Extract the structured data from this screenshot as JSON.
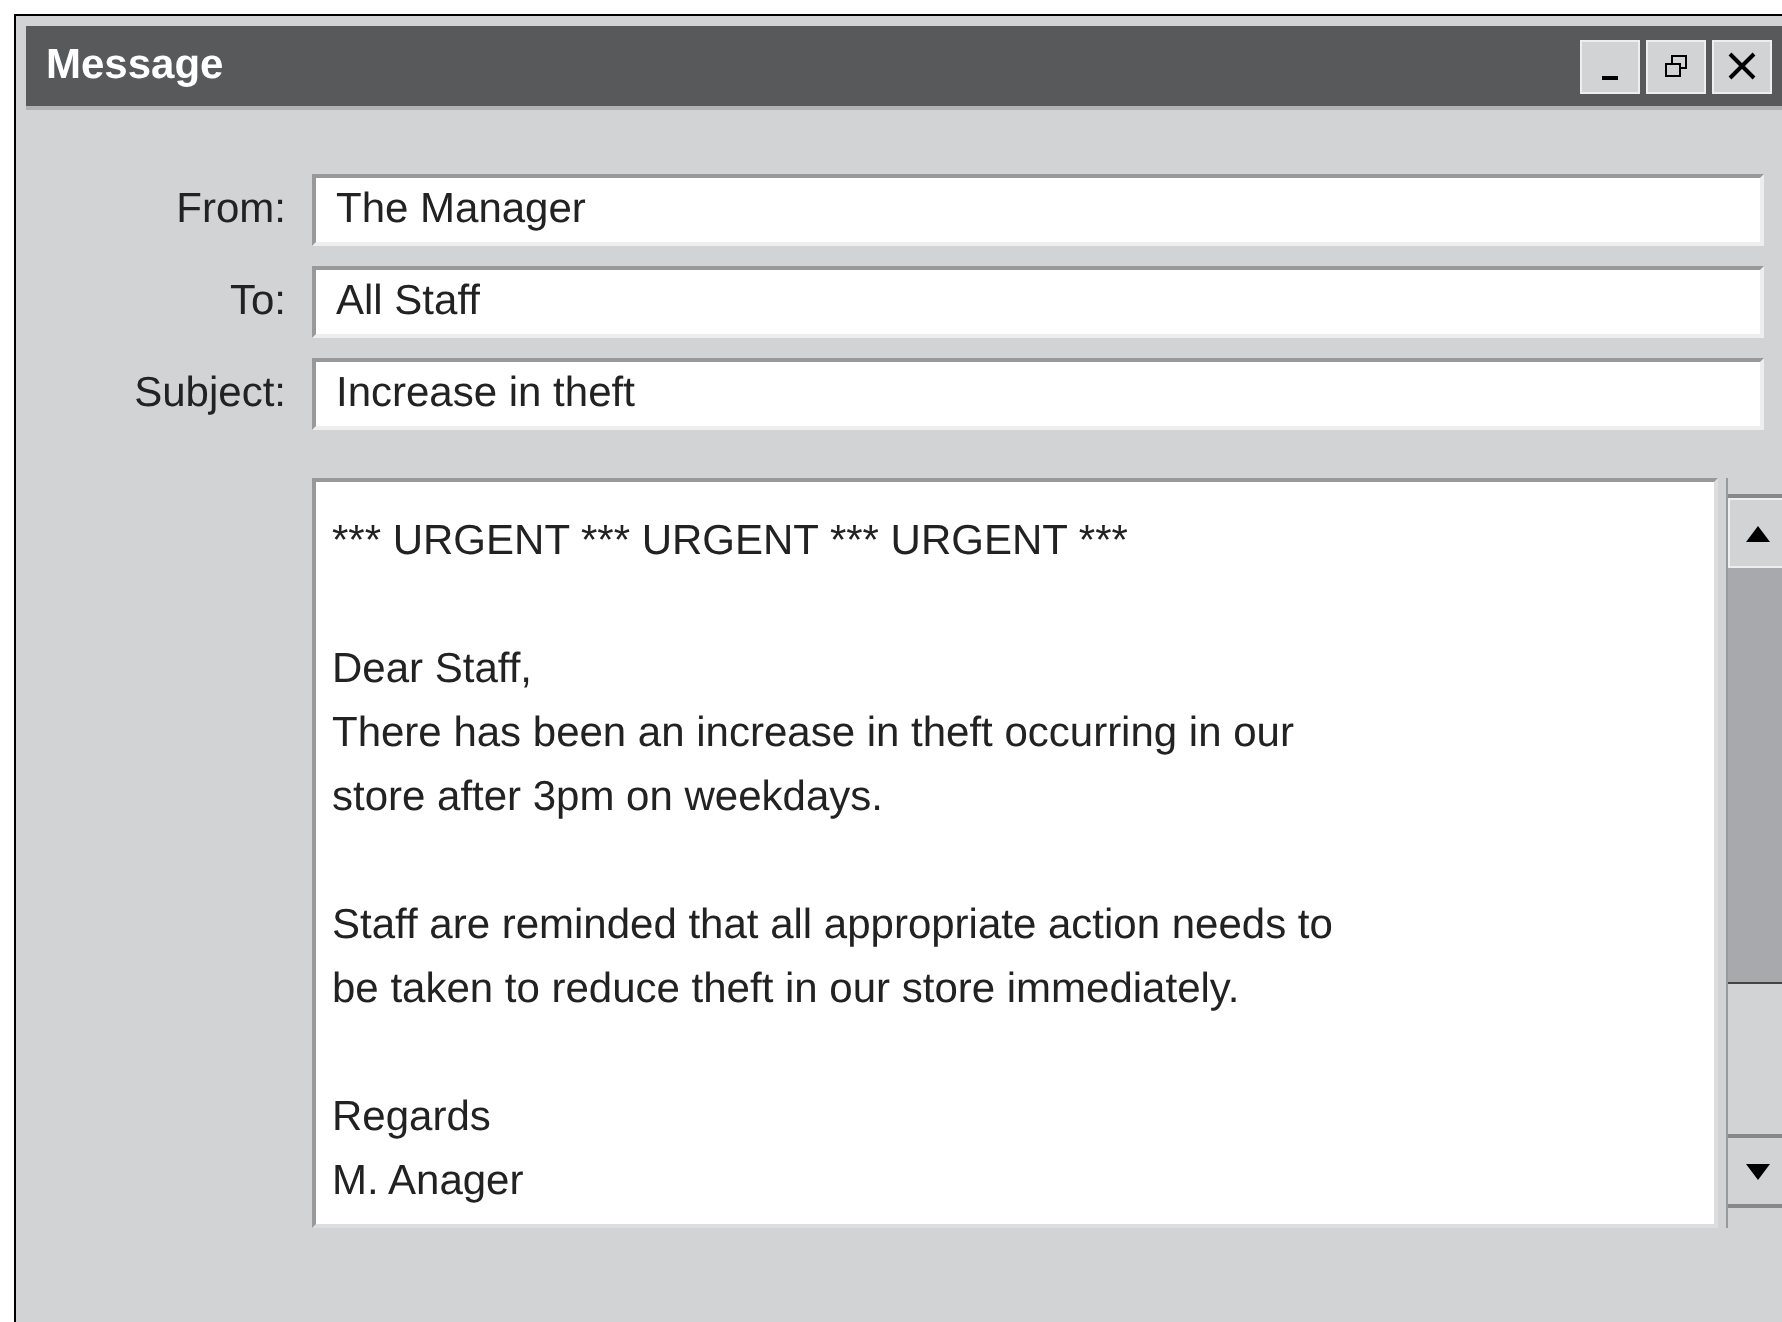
{
  "window": {
    "title": "Message"
  },
  "fields": [
    {
      "label": "From:",
      "value": "The Manager"
    },
    {
      "label": "To:",
      "value": "All Staff"
    },
    {
      "label": "Subject:",
      "value": "Increase in theft"
    }
  ],
  "message": {
    "paragraphs": [
      [
        "*** URGENT *** URGENT *** URGENT ***"
      ],
      [
        "Dear Staff,",
        "There has been an increase in theft occurring in our",
        "store after 3pm on weekdays."
      ],
      [
        "Staff are reminded that all appropriate action needs to",
        "be taken to reduce theft in our store immediately."
      ],
      [
        "Regards",
        "M. Anager"
      ]
    ]
  }
}
